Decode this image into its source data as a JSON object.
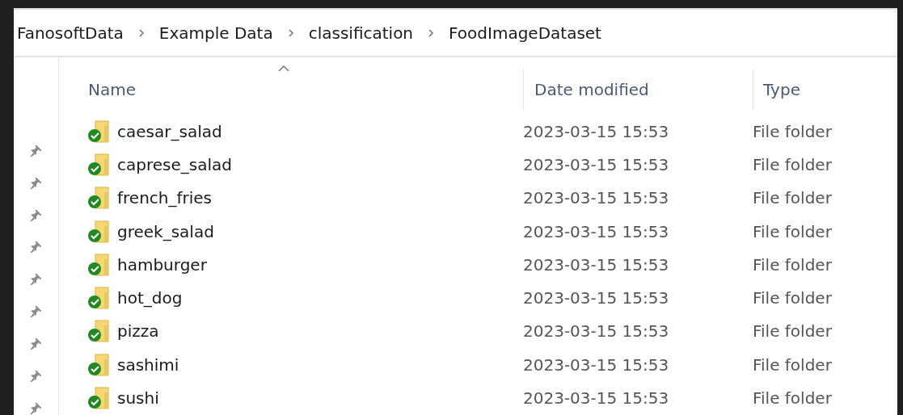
{
  "breadcrumb": [
    "FanosoftData",
    "Example Data",
    "classification",
    "FoodImageDataset"
  ],
  "columns": [
    {
      "label": "Name",
      "sorted": true
    },
    {
      "label": "Date modified",
      "sorted": false
    },
    {
      "label": "Type",
      "sorted": false
    }
  ],
  "rows": [
    {
      "name": "caesar_salad",
      "date_modified": "2023-03-15 15:53",
      "type": "File folder"
    },
    {
      "name": "caprese_salad",
      "date_modified": "2023-03-15 15:53",
      "type": "File folder"
    },
    {
      "name": "french_fries",
      "date_modified": "2023-03-15 15:53",
      "type": "File folder"
    },
    {
      "name": "greek_salad",
      "date_modified": "2023-03-15 15:53",
      "type": "File folder"
    },
    {
      "name": "hamburger",
      "date_modified": "2023-03-15 15:53",
      "type": "File folder"
    },
    {
      "name": "hot_dog",
      "date_modified": "2023-03-15 15:53",
      "type": "File folder"
    },
    {
      "name": "pizza",
      "date_modified": "2023-03-15 15:53",
      "type": "File folder"
    },
    {
      "name": "sashimi",
      "date_modified": "2023-03-15 15:53",
      "type": "File folder"
    },
    {
      "name": "sushi",
      "date_modified": "2023-03-15 15:53",
      "type": "File folder"
    }
  ]
}
